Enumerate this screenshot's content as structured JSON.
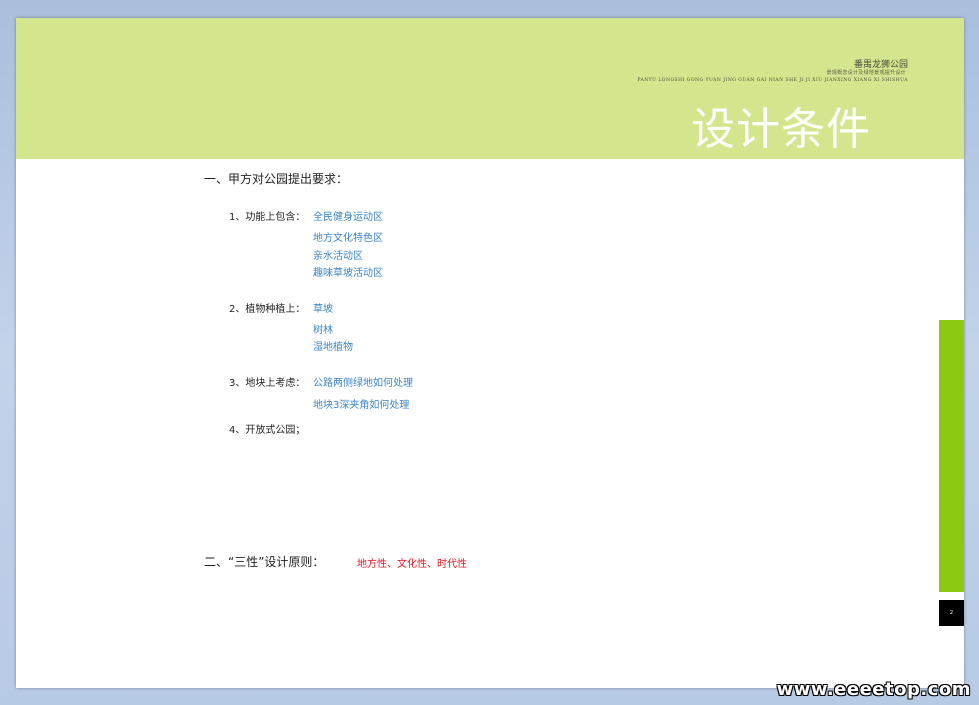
{
  "header": {
    "title_cn": "番禺龙狮公园",
    "subtitle_cn": "景观概念设计及绿地景观提升设计",
    "pinyin": "PANYU LONGSHI GONG YUAN JING GUAN GAI NIAN SHE JI JI XIU JIANXING XIANG XI SHISHUA",
    "page_title": "设计条件"
  },
  "section1": {
    "heading": "一、甲方对公园提出要求：",
    "items": [
      {
        "label": "1、功能上包含：",
        "values": [
          "全民健身运动区",
          "地方文化特色区",
          "亲水活动区",
          "趣味草坡活动区"
        ]
      },
      {
        "label": "2、植物种植上：",
        "values": [
          "草坡",
          "树林",
          "湿地植物"
        ]
      },
      {
        "label": "3、地块上考虑：",
        "values": [
          "公路两侧绿地如何处理",
          "地块3深夹角如何处理"
        ]
      },
      {
        "label": "4、开放式公园；",
        "values": []
      }
    ]
  },
  "section2": {
    "heading": "二、“三性”设计原则：",
    "value": "地方性、文化性、时代性"
  },
  "page_number": "2",
  "watermark": "www.eeeetop.com",
  "colors": {
    "header_band": "#d4e68d",
    "accent_green": "#8cca12",
    "value_blue": "#3a86c8",
    "principle_red": "#e0141e"
  }
}
